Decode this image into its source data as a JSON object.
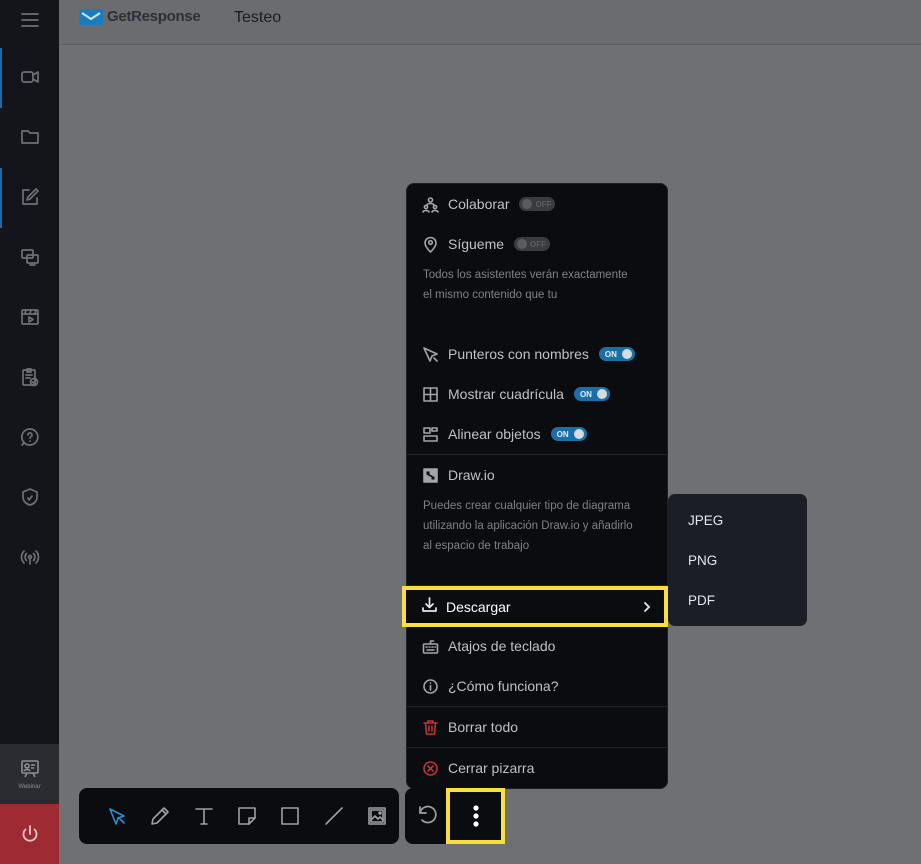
{
  "header": {
    "logo_text": "GetResponse",
    "title": "Testeo"
  },
  "sidebar": {
    "items": [
      "menu-icon",
      "video-icon",
      "folder-icon",
      "edit-icon",
      "screens-icon",
      "media-icon",
      "clipboard-check-icon",
      "help-icon",
      "shield-icon",
      "broadcast-icon"
    ],
    "webinar_label": "Webinar"
  },
  "menu": {
    "collaborate": {
      "label": "Colaborar",
      "toggle": "OFF"
    },
    "follow": {
      "label": "Sígueme",
      "toggle": "OFF"
    },
    "follow_desc": "Todos los asistentes verán exactamente el mismo contenido que tu",
    "pointers": {
      "label": "Punteros con nombres",
      "toggle": "ON"
    },
    "grid": {
      "label": "Mostrar cuadrícula",
      "toggle": "ON"
    },
    "align": {
      "label": "Alinear objetos",
      "toggle": "ON"
    },
    "drawio": {
      "label": "Draw.io"
    },
    "drawio_desc": "Puedes crear cualquier tipo de diagrama utilizando la aplicación Draw.io y añadirlo al espacio de trabajo",
    "download": {
      "label": "Descargar"
    },
    "shortcuts": {
      "label": "Atajos de teclado"
    },
    "how": {
      "label": "¿Cómo funciona?"
    },
    "clear": {
      "label": "Borrar todo"
    },
    "close": {
      "label": "Cerrar pizarra"
    }
  },
  "submenu": {
    "jpeg": "JPEG",
    "png": "PNG",
    "pdf": "PDF"
  },
  "toolbar": {
    "tools": [
      "select-icon",
      "pencil-icon",
      "text-icon",
      "note-icon",
      "rectangle-icon",
      "line-icon",
      "image-icon"
    ]
  },
  "colors": {
    "accent": "#1c6fa6",
    "highlight": "#f8df3e",
    "danger": "#c2333b"
  }
}
